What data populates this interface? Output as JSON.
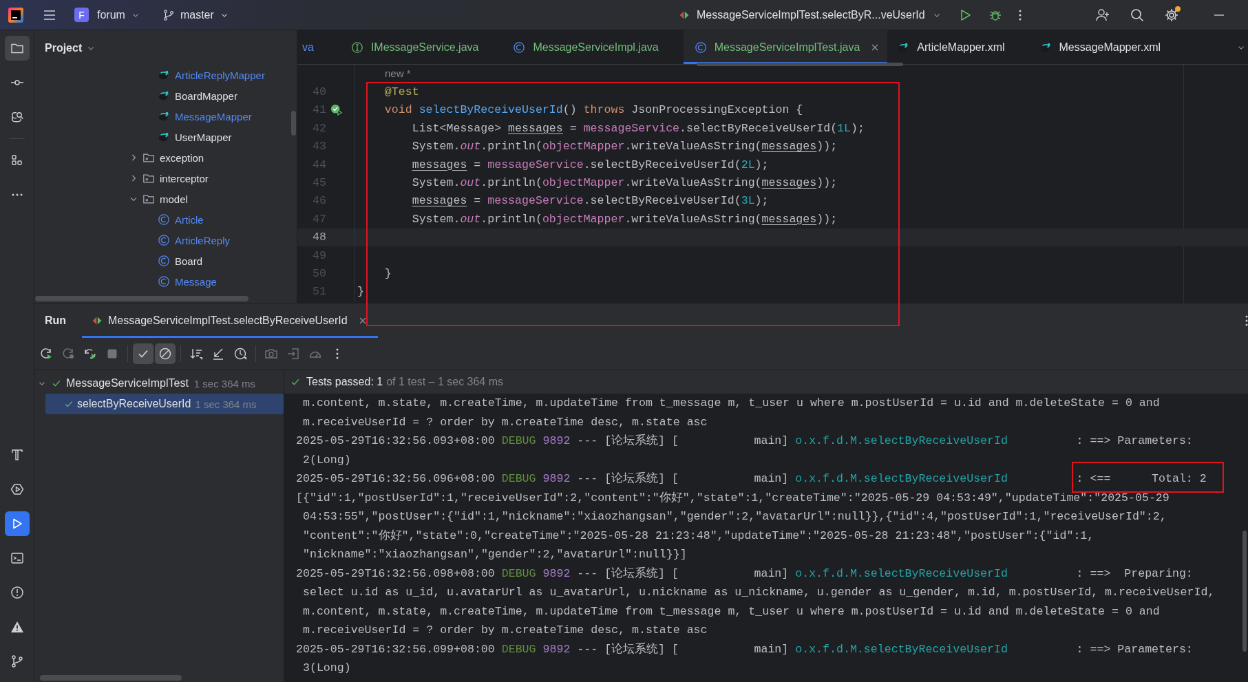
{
  "top_bar": {
    "project_badge": "F",
    "project": "forum",
    "branch": "master",
    "run_config": "MessageServiceImplTest.selectByR...veUserId",
    "settings_badge": true
  },
  "left_toolbar": {
    "top": [
      {
        "selected": true
      },
      {
        "selected": false
      },
      {
        "selected": false
      },
      {
        "selected": false
      },
      {
        "selected": false
      }
    ],
    "bottom": [
      {
        "selected": false
      },
      {
        "selected": false
      },
      {
        "selected": true
      },
      {
        "selected": false
      },
      {
        "selected": false
      },
      {
        "selected": false
      },
      {
        "selected": false
      }
    ]
  },
  "project_panel": {
    "title": "Project",
    "partial_folder_children": [
      {
        "label": "ArticleReplyMapper",
        "kind": "mapper",
        "color": "#548af7"
      },
      {
        "label": "BoardMapper",
        "kind": "mapper",
        "color": "#dfe1e5"
      },
      {
        "label": "MessageMapper",
        "kind": "mapper",
        "color": "#548af7"
      },
      {
        "label": "UserMapper",
        "kind": "mapper",
        "color": "#dfe1e5"
      }
    ],
    "nodes": [
      {
        "label": "exception",
        "kind": "folder",
        "color": "#dfe1e5",
        "expanded": false
      },
      {
        "label": "interceptor",
        "kind": "folder",
        "color": "#dfe1e5",
        "expanded": false
      },
      {
        "label": "model",
        "kind": "folder",
        "color": "#dfe1e5",
        "expanded": true,
        "children": [
          {
            "label": "Article",
            "kind": "class",
            "color": "#548af7"
          },
          {
            "label": "ArticleReply",
            "kind": "class",
            "color": "#548af7"
          },
          {
            "label": "Board",
            "kind": "class",
            "color": "#dfe1e5"
          },
          {
            "label": "Message",
            "kind": "class",
            "color": "#548af7"
          }
        ]
      }
    ]
  },
  "editor": {
    "tabs": [
      {
        "label": "va",
        "kind": "cut",
        "color": "#548af7",
        "selected": false
      },
      {
        "label": "IMessageService.java",
        "kind": "interface",
        "color": "#73bd79",
        "selected": false
      },
      {
        "label": "MessageServiceImpl.java",
        "kind": "class",
        "color": "#73bd79",
        "selected": false
      },
      {
        "label": "MessageServiceImplTest.java",
        "kind": "class",
        "color": "#73bd79",
        "selected": true
      },
      {
        "label": "ArticleMapper.xml",
        "kind": "mapper",
        "color": "#dfe1e5",
        "selected": false
      },
      {
        "label": "MessageMapper.xml",
        "kind": "mapper",
        "color": "#dfe1e5",
        "selected": false
      }
    ],
    "hint": "new *",
    "code_lines": [
      {
        "number": "40",
        "current": false,
        "segments": [
          {
            "text": "    @Test",
            "kind": "annotation"
          }
        ]
      },
      {
        "number": "41",
        "current": false,
        "test_passed_marker": true,
        "segments": [
          {
            "text": "    void ",
            "kind": "keyword"
          },
          {
            "text": "selectByReceiveUserId",
            "kind": "method_decl"
          },
          {
            "text": "() ",
            "kind": "plain"
          },
          {
            "text": "throws ",
            "kind": "keyword"
          },
          {
            "text": "JsonProcessingException {",
            "kind": "plain"
          }
        ]
      },
      {
        "number": "42",
        "current": false,
        "segments": [
          {
            "text": "        List<Message> ",
            "kind": "plain"
          },
          {
            "text": "messages",
            "kind": "variable"
          },
          {
            "text": " = ",
            "kind": "plain"
          },
          {
            "text": "messageService",
            "kind": "field"
          },
          {
            "text": ".selectByReceiveUserId(",
            "kind": "plain"
          },
          {
            "text": "1L",
            "kind": "number"
          },
          {
            "text": ");",
            "kind": "plain"
          }
        ]
      },
      {
        "number": "43",
        "current": false,
        "segments": [
          {
            "text": "        System.",
            "kind": "plain"
          },
          {
            "text": "out",
            "kind": "static"
          },
          {
            "text": ".println(",
            "kind": "plain"
          },
          {
            "text": "objectMapper",
            "kind": "field"
          },
          {
            "text": ".writeValueAsString(",
            "kind": "plain"
          },
          {
            "text": "messages",
            "kind": "variable"
          },
          {
            "text": "));",
            "kind": "plain"
          }
        ]
      },
      {
        "number": "44",
        "current": false,
        "segments": [
          {
            "text": "        messages",
            "kind": "variable"
          },
          {
            "text": " = ",
            "kind": "plain"
          },
          {
            "text": "messageService",
            "kind": "field"
          },
          {
            "text": ".selectByReceiveUserId(",
            "kind": "plain"
          },
          {
            "text": "2L",
            "kind": "number"
          },
          {
            "text": ");",
            "kind": "plain"
          }
        ]
      },
      {
        "number": "45",
        "current": false,
        "segments": [
          {
            "text": "        System.",
            "kind": "plain"
          },
          {
            "text": "out",
            "kind": "static"
          },
          {
            "text": ".println(",
            "kind": "plain"
          },
          {
            "text": "objectMapper",
            "kind": "field"
          },
          {
            "text": ".writeValueAsString(",
            "kind": "plain"
          },
          {
            "text": "messages",
            "kind": "variable"
          },
          {
            "text": "));",
            "kind": "plain"
          }
        ]
      },
      {
        "number": "46",
        "current": false,
        "segments": [
          {
            "text": "        messages",
            "kind": "variable"
          },
          {
            "text": " = ",
            "kind": "plain"
          },
          {
            "text": "messageService",
            "kind": "field"
          },
          {
            "text": ".selectByReceiveUserId(",
            "kind": "plain"
          },
          {
            "text": "3L",
            "kind": "number"
          },
          {
            "text": ");",
            "kind": "plain"
          }
        ]
      },
      {
        "number": "47",
        "current": false,
        "segments": [
          {
            "text": "        System.",
            "kind": "plain"
          },
          {
            "text": "out",
            "kind": "static"
          },
          {
            "text": ".println(",
            "kind": "plain"
          },
          {
            "text": "objectMapper",
            "kind": "field"
          },
          {
            "text": ".writeValueAsString(",
            "kind": "plain"
          },
          {
            "text": "messages",
            "kind": "variable"
          },
          {
            "text": "));",
            "kind": "plain"
          }
        ]
      },
      {
        "number": "48",
        "current": true
      },
      {
        "number": "49",
        "current": false
      },
      {
        "number": "50",
        "current": false,
        "segments": [
          {
            "text": "    }",
            "kind": "plain"
          }
        ]
      },
      {
        "number": "51",
        "current": false,
        "segments": [
          {
            "text": "}",
            "kind": "plain"
          }
        ]
      }
    ]
  },
  "run_panel": {
    "title": "Run",
    "tab": {
      "label": "MessageServiceImplTest.selectByReceiveUserId",
      "selected": true
    },
    "toolbar": [
      [
        {
          "on": false,
          "disabled": false
        },
        {
          "on": false,
          "disabled": true
        },
        {
          "on": false,
          "disabled": false
        },
        {
          "on": false,
          "disabled": true
        }
      ],
      [
        {
          "on": true,
          "disabled": false
        },
        {
          "on": true,
          "disabled": false
        }
      ],
      [
        {
          "on": false,
          "disabled": false
        },
        {
          "on": false,
          "disabled": false
        },
        {
          "on": false,
          "disabled": false
        }
      ],
      [
        {
          "on": false,
          "disabled": true
        },
        {
          "on": false,
          "disabled": true
        },
        {
          "on": false,
          "disabled": true
        },
        {
          "on": false,
          "disabled": false
        }
      ]
    ],
    "tests": [
      {
        "label": "MessageServiceImplTest",
        "duration": "1 sec 364 ms",
        "passed": true,
        "expanded": true,
        "selected": false,
        "children": [
          {
            "label": "selectByReceiveUserId",
            "duration": "1 sec 364 ms",
            "passed": true,
            "selected": true
          }
        ]
      }
    ],
    "summary": "Tests passed: 1",
    "summary_detail": "of 1 test – 1 sec 364 ms",
    "console": [
      {
        "continued": true,
        "segments": [
          {
            "text": "m.content, m.state, m.createTime, m.updateTime from t_message m, t_user u where m.postUserId = u.id and m.deleteState = 0 and",
            "kind": "text"
          }
        ]
      },
      {
        "continued": true,
        "segments": [
          {
            "text": "m.receiveUserId = ? order by m.createTime desc, m.state asc",
            "kind": "text"
          }
        ]
      },
      {
        "continued": false,
        "segments": [
          {
            "text": "2025-05-29T16:32:56.093+08:00 ",
            "kind": "text"
          },
          {
            "text": "DEBUG",
            "kind": "level"
          },
          {
            "text": " 9892",
            "kind": "pid"
          },
          {
            "text": " --- [论坛系统] [           main] ",
            "kind": "text"
          },
          {
            "text": "o.x.f.d.M.selectByReceiveUserId",
            "kind": "logger"
          },
          {
            "text": "          : ==> Parameters:",
            "kind": "text"
          }
        ]
      },
      {
        "continued": true,
        "segments": [
          {
            "text": "2(Long)",
            "kind": "text"
          }
        ]
      },
      {
        "continued": false,
        "segments": [
          {
            "text": "2025-05-29T16:32:56.096+08:00 ",
            "kind": "text"
          },
          {
            "text": "DEBUG",
            "kind": "level"
          },
          {
            "text": " 9892",
            "kind": "pid"
          },
          {
            "text": " --- [论坛系统] [           main] ",
            "kind": "text"
          },
          {
            "text": "o.x.f.d.M.selectByReceiveUserId",
            "kind": "logger"
          },
          {
            "text": "          : <==      Total: 2",
            "kind": "text"
          }
        ]
      },
      {
        "continued": false,
        "segments": [
          {
            "text": "[{\"id\":1,\"postUserId\":1,\"receiveUserId\":2,\"content\":\"你好\",\"state\":1,\"createTime\":\"2025-05-29 04:53:49\",\"updateTime\":\"2025-05-29",
            "kind": "text"
          }
        ]
      },
      {
        "continued": true,
        "segments": [
          {
            "text": "04:53:55\",\"postUser\":{\"id\":1,\"nickname\":\"xiaozhangsan\",\"gender\":2,\"avatarUrl\":null}},{\"id\":4,\"postUserId\":1,\"receiveUserId\":2,",
            "kind": "text"
          }
        ]
      },
      {
        "continued": true,
        "segments": [
          {
            "text": "\"content\":\"你好\",\"state\":0,\"createTime\":\"2025-05-28 21:23:48\",\"updateTime\":\"2025-05-28 21:23:48\",\"postUser\":{\"id\":1,",
            "kind": "text"
          }
        ]
      },
      {
        "continued": true,
        "segments": [
          {
            "text": "\"nickname\":\"xiaozhangsan\",\"gender\":2,\"avatarUrl\":null}}]",
            "kind": "text"
          }
        ]
      },
      {
        "continued": false,
        "segments": [
          {
            "text": "2025-05-29T16:32:56.098+08:00 ",
            "kind": "text"
          },
          {
            "text": "DEBUG",
            "kind": "level"
          },
          {
            "text": " 9892",
            "kind": "pid"
          },
          {
            "text": " --- [论坛系统] [           main] ",
            "kind": "text"
          },
          {
            "text": "o.x.f.d.M.selectByReceiveUserId",
            "kind": "logger"
          },
          {
            "text": "          : ==>  Preparing:",
            "kind": "text"
          }
        ]
      },
      {
        "continued": true,
        "segments": [
          {
            "text": "select u.id as u_id, u.avatarUrl as u_avatarUrl, u.nickname as u_nickname, u.gender as u_gender, m.id, m.postUserId, m.receiveUserId,",
            "kind": "text"
          }
        ]
      },
      {
        "continued": true,
        "segments": [
          {
            "text": "m.content, m.state, m.createTime, m.updateTime from t_message m, t_user u where m.postUserId = u.id and m.deleteState = 0 and",
            "kind": "text"
          }
        ]
      },
      {
        "continued": true,
        "segments": [
          {
            "text": "m.receiveUserId = ? order by m.createTime desc, m.state asc",
            "kind": "text"
          }
        ]
      },
      {
        "continued": false,
        "segments": [
          {
            "text": "2025-05-29T16:32:56.099+08:00 ",
            "kind": "text"
          },
          {
            "text": "DEBUG",
            "kind": "level"
          },
          {
            "text": " 9892",
            "kind": "pid"
          },
          {
            "text": " --- [论坛系统] [           main] ",
            "kind": "text"
          },
          {
            "text": "o.x.f.d.M.selectByReceiveUserId",
            "kind": "logger"
          },
          {
            "text": "          : ==> Parameters:",
            "kind": "text"
          }
        ]
      },
      {
        "continued": true,
        "segments": [
          {
            "text": "3(Long)",
            "kind": "text"
          }
        ]
      }
    ]
  }
}
